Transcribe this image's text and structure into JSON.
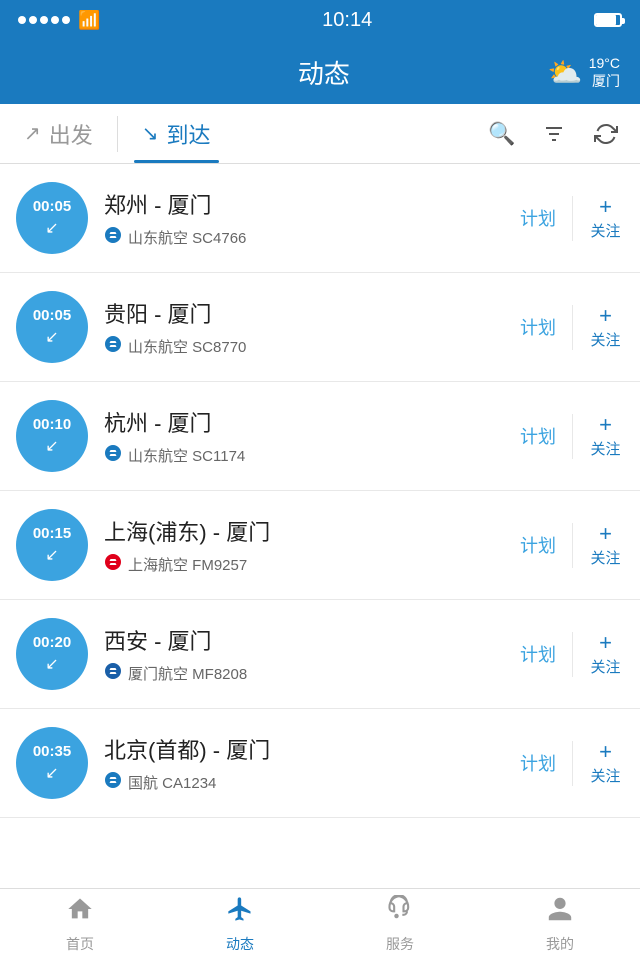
{
  "statusBar": {
    "time": "10:14",
    "batteryIcon": "🔋"
  },
  "header": {
    "title": "动态",
    "weather": {
      "temp": "19°C",
      "city": "厦门",
      "icon": "⛅"
    }
  },
  "tabs": {
    "departure": {
      "label": "出发",
      "active": false,
      "arrowIcon": "↗"
    },
    "arrival": {
      "label": "到达",
      "active": true,
      "arrowIcon": "↘"
    },
    "actions": {
      "search": "🔍",
      "filter": "⚗",
      "refresh": "↺"
    }
  },
  "flights": [
    {
      "time": "00:05",
      "from": "郑州",
      "to": "厦门",
      "airlineName": "山东航空",
      "flightNo": "SC4766",
      "status": "计划"
    },
    {
      "time": "00:05",
      "from": "贵阳",
      "to": "厦门",
      "airlineName": "山东航空",
      "flightNo": "SC8770",
      "status": "计划"
    },
    {
      "time": "00:10",
      "from": "杭州",
      "to": "厦门",
      "airlineName": "山东航空",
      "flightNo": "SC1174",
      "status": "计划"
    },
    {
      "time": "00:15",
      "from": "上海(浦东)",
      "to": "厦门",
      "airlineName": "上海航空",
      "flightNo": "FM9257",
      "status": "计划"
    },
    {
      "time": "00:20",
      "from": "西安",
      "to": "厦门",
      "airlineName": "厦门航空",
      "flightNo": "MF8208",
      "status": "计划"
    },
    {
      "time": "00:35",
      "from": "北京(首都)",
      "to": "厦门",
      "airlineName": "国航",
      "flightNo": "CA1234",
      "status": "计划"
    }
  ],
  "bottomNav": {
    "items": [
      {
        "label": "首页",
        "icon": "🏠",
        "active": false
      },
      {
        "label": "动态",
        "icon": "✈",
        "active": true
      },
      {
        "label": "服务",
        "icon": "🎧",
        "active": false
      },
      {
        "label": "我的",
        "icon": "👤",
        "active": false
      }
    ]
  },
  "followLabel": "关注",
  "followPlus": "+"
}
